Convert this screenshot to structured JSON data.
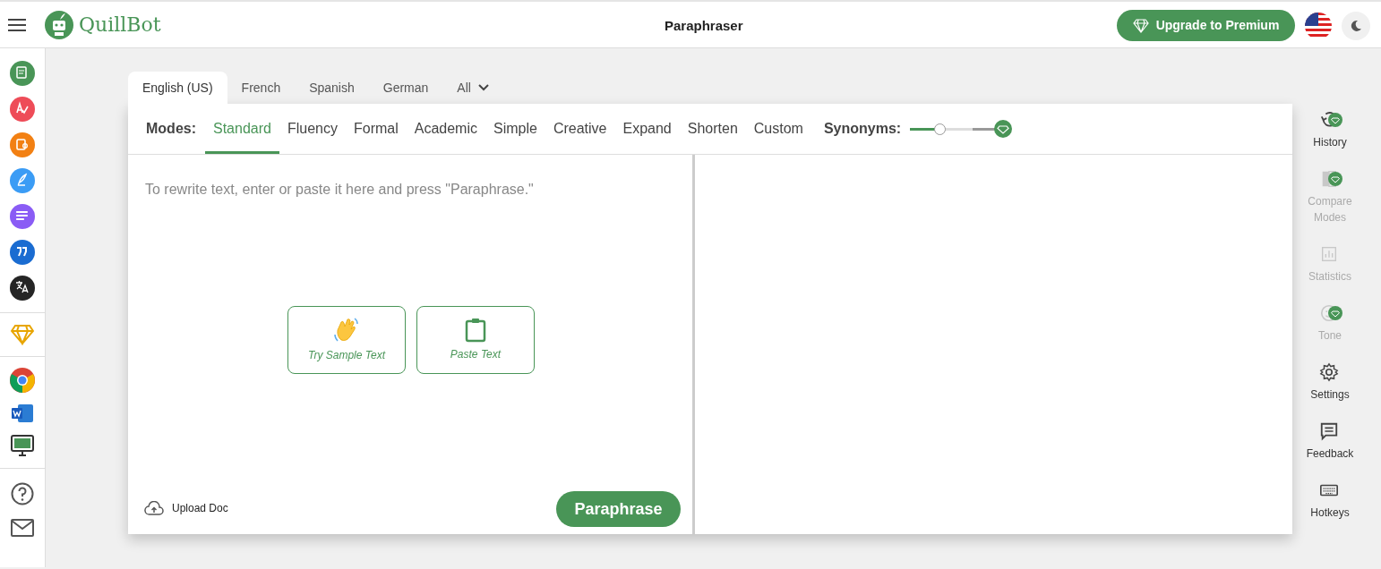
{
  "header": {
    "logo_text": "QuillBot",
    "title": "Paraphraser",
    "upgrade_button": "Upgrade to Premium"
  },
  "sidebar": {
    "tools": [
      {
        "color": "#499557"
      },
      {
        "color": "#ee4c58"
      },
      {
        "color": "#f28013"
      },
      {
        "color": "#3b9cf5"
      },
      {
        "color": "#8a5cf5"
      },
      {
        "color": "#1a6cd1"
      },
      {
        "color": "#252525"
      }
    ]
  },
  "language_tabs": [
    {
      "label": "English (US)",
      "selected": true
    },
    {
      "label": "French",
      "selected": false
    },
    {
      "label": "Spanish",
      "selected": false
    },
    {
      "label": "German",
      "selected": false
    },
    {
      "label": "All",
      "selected": false
    }
  ],
  "modes": {
    "label": "Modes:",
    "items": [
      {
        "label": "Standard",
        "selected": true
      },
      {
        "label": "Fluency",
        "selected": false
      },
      {
        "label": "Formal",
        "selected": false
      },
      {
        "label": "Academic",
        "selected": false
      },
      {
        "label": "Simple",
        "selected": false
      },
      {
        "label": "Creative",
        "selected": false
      },
      {
        "label": "Expand",
        "selected": false
      },
      {
        "label": "Shorten",
        "selected": false
      },
      {
        "label": "Custom",
        "selected": false
      }
    ]
  },
  "synonyms": {
    "label": "Synonyms:",
    "level": 0.33
  },
  "input": {
    "placeholder": "To rewrite text, enter or paste it here and press \"Paraphrase.\"",
    "sample_button": "Try Sample Text",
    "paste_button": "Paste Text",
    "upload": "Upload Doc",
    "paraphrase_button": "Paraphrase"
  },
  "right_rail": [
    {
      "kind": "history",
      "label": "History",
      "disabled": false,
      "premium": true
    },
    {
      "kind": "compare",
      "label": "Compare Modes",
      "disabled": true,
      "premium": true
    },
    {
      "kind": "statistics",
      "label": "Statistics",
      "disabled": true,
      "premium": false
    },
    {
      "kind": "tone",
      "label": "Tone",
      "disabled": true,
      "premium": true
    },
    {
      "kind": "settings",
      "label": "Settings",
      "disabled": false,
      "premium": false
    },
    {
      "kind": "feedback",
      "label": "Feedback",
      "disabled": false,
      "premium": false
    },
    {
      "kind": "hotkeys",
      "label": "Hotkeys",
      "disabled": false,
      "premium": false
    }
  ]
}
